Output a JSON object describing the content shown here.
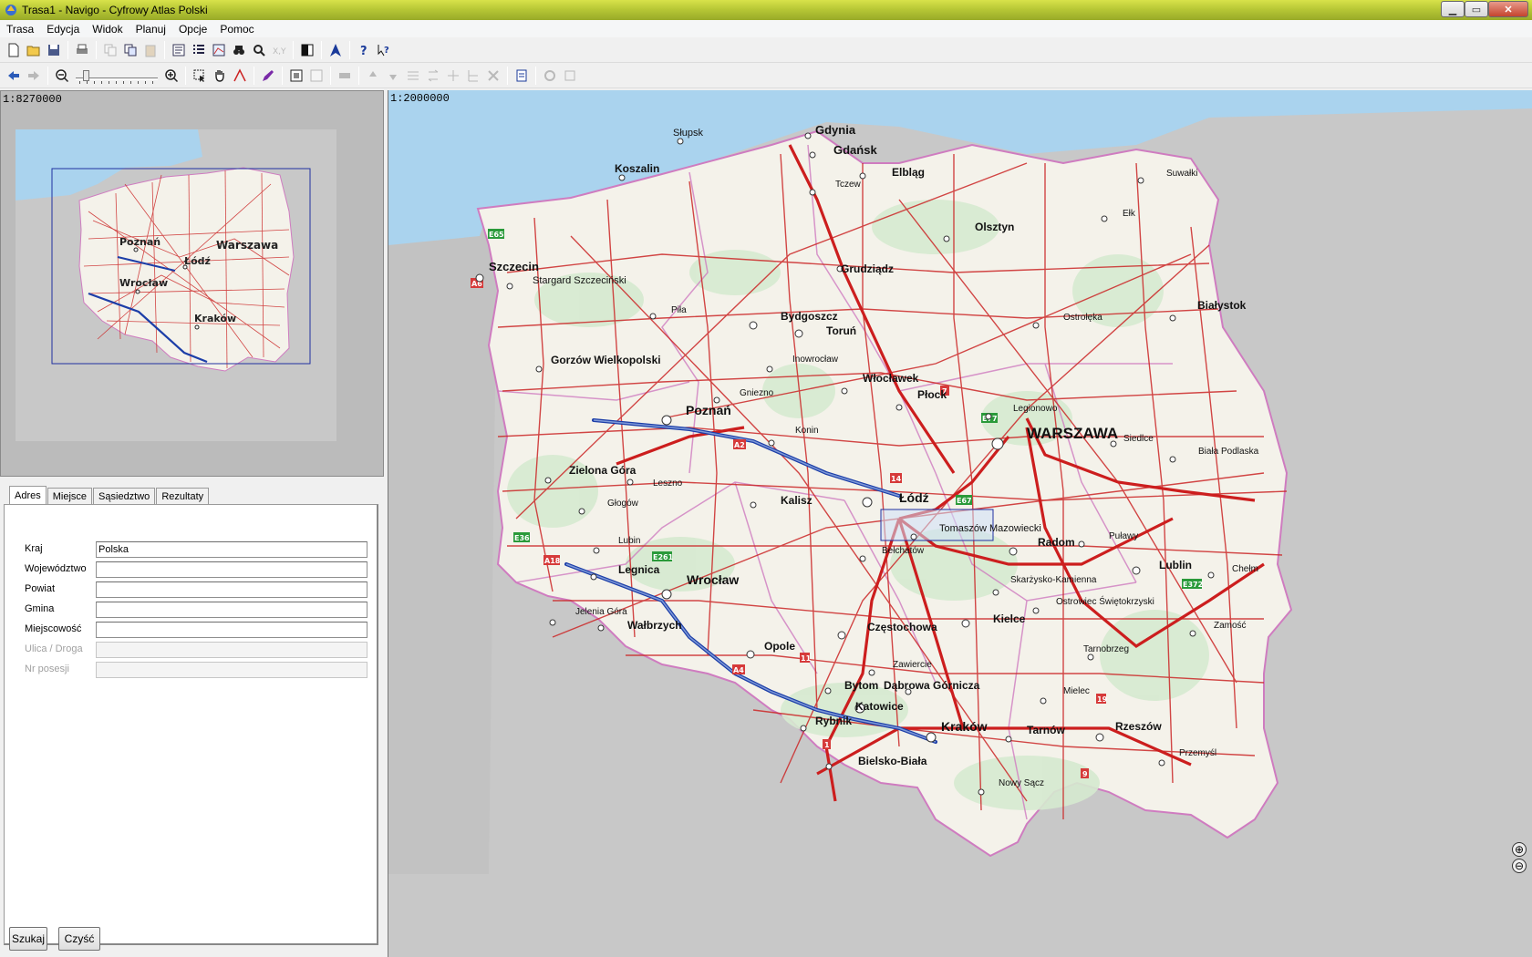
{
  "window": {
    "title": "Trasa1 - Navigo - Cyfrowy Atlas Polski"
  },
  "menu": [
    "Trasa",
    "Edycja",
    "Widok",
    "Planuj",
    "Opcje",
    "Pomoc"
  ],
  "overview": {
    "scale": "1:8270000",
    "cities": {
      "poznan": "Poznań",
      "lodz": "Łódź",
      "warszawa": "Warszawa",
      "wroclaw": "Wrocław",
      "krakow": "Kraków"
    }
  },
  "main_map": {
    "scale": "1:2000000",
    "cities": {
      "slupsk": "Słupsk",
      "gdynia": "Gdynia",
      "gdansk": "Gdańsk",
      "koszalin": "Koszalin",
      "elblag": "Elbląg",
      "tczew": "Tczew",
      "suwalki": "Suwałki",
      "elk": "Ełk",
      "olsztyn": "Olsztyn",
      "szczecin": "Szczecin",
      "stargard": "Stargard Szczeciński",
      "grudziadz": "Grudziądz",
      "bialystok": "Białystok",
      "pila": "Piła",
      "bydgoszcz": "Bydgoszcz",
      "torun": "Toruń",
      "ostroleka": "Ostrołęka",
      "gorzow": "Gorzów Wielkopolski",
      "inowroclaw": "Inowrocław",
      "wloclawek": "Włocławek",
      "gniezno": "Gniezno",
      "plock": "Płock",
      "legionowo": "Legionowo",
      "poznan": "Poznań",
      "konin": "Konin",
      "warszawa": "WARSZAWA",
      "siedlce": "Siedlce",
      "biala": "Biała Podlaska",
      "zielona": "Zielona Góra",
      "leszno": "Leszno",
      "lodz": "Łódź",
      "kalisz": "Kalisz",
      "glogow": "Głogów",
      "tomaszow": "Tomaszów Mazowiecki",
      "pulawy": "Puławy",
      "radom": "Radom",
      "lubin": "Lubin",
      "belchatow": "Bełchatów",
      "lublin": "Lublin",
      "chelm": "Chełm",
      "legnica": "Legnica",
      "wroclaw": "Wrocław",
      "skarzysko": "Skarżysko-Kamienna",
      "ostrowiec": "Ostrowiec Świętokrzyski",
      "jelenia": "Jelenia Góra",
      "walbrzych": "Wałbrzych",
      "czestochowa": "Częstochowa",
      "kielce": "Kielce",
      "zamosc": "Zamość",
      "opole": "Opole",
      "tarnobrzeg": "Tarnobrzeg",
      "zawiercie": "Zawiercie",
      "bytom": "Bytom",
      "dabrowa": "Dąbrowa Górnicza",
      "mielec": "Mielec",
      "katowice": "Katowice",
      "rybnik": "Rybnik",
      "krakow": "Kraków",
      "tarnow": "Tarnów",
      "rzeszow": "Rzeszów",
      "przemysl": "Przemyśl",
      "bielsko": "Bielsko-Biała",
      "nowysacz": "Nowy Sącz"
    },
    "road_shields": {
      "e65": "E65",
      "a6": "A6",
      "e77": "E77",
      "a2": "A2",
      "s7": "7",
      "r14": "14",
      "e67": "E67",
      "e36": "E36",
      "a18": "A18",
      "e261": "E261",
      "e372": "E372",
      "a4": "A4",
      "r11": "11",
      "r19": "19",
      "s1": "1",
      "r9": "9"
    }
  },
  "search": {
    "tabs": [
      "Adres",
      "Miejsce",
      "Sąsiedztwo",
      "Rezultaty"
    ],
    "fields": [
      {
        "label": "Kraj",
        "value": "Polska"
      },
      {
        "label": "Województwo",
        "value": ""
      },
      {
        "label": "Powiat",
        "value": ""
      },
      {
        "label": "Gmina",
        "value": ""
      },
      {
        "label": "Miejscowość",
        "value": ""
      },
      {
        "label": "Ulica / Droga",
        "value": ""
      },
      {
        "label": "Nr posesji",
        "value": ""
      }
    ],
    "buttons": {
      "search": "Szukaj",
      "clear": "Czyść"
    }
  },
  "zoom_controls": {
    "in": "⊕",
    "out": "⊖"
  },
  "colors": {
    "water": "#aad3ee",
    "land": "#f4f2ea",
    "outside": "#c8c8c8",
    "road": "#cc2828",
    "route": "#1c3ea8",
    "border": "#cf7cc0"
  }
}
